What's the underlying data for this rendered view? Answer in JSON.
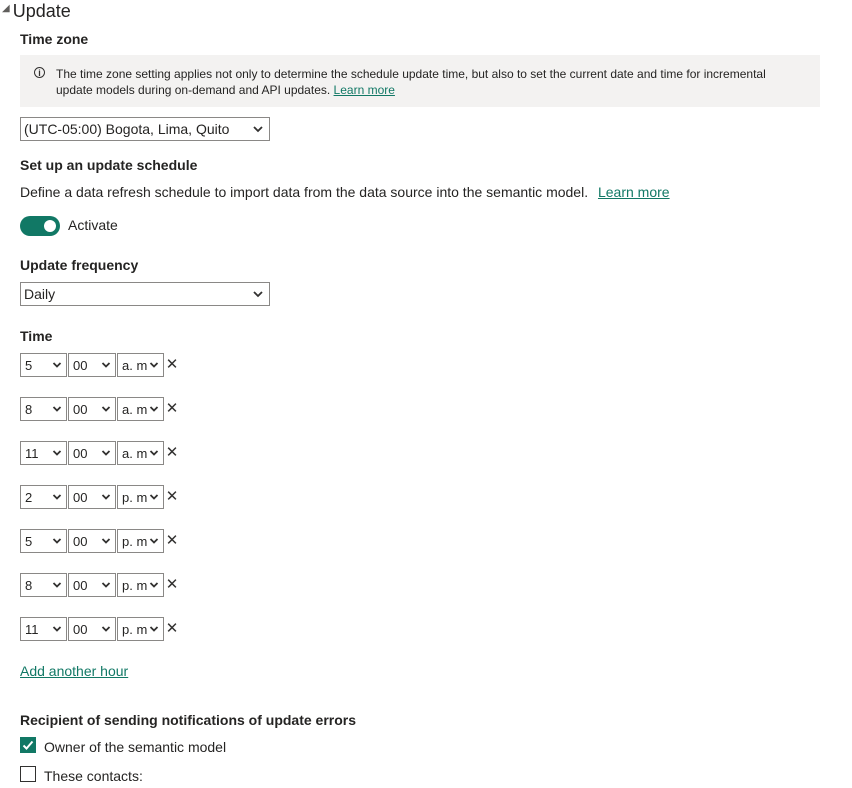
{
  "section": {
    "title": "Update",
    "collapse_icon": "collapse-triangle-icon"
  },
  "timezone": {
    "label": "Time zone",
    "info_text": "The time zone setting applies not only to determine the schedule update time, but also to set the current date and time for incremental update models during on-demand and API updates.",
    "info_link": "Learn more",
    "selected": "(UTC-05:00) Bogota, Lima, Quito"
  },
  "schedule": {
    "heading": "Set up an update schedule",
    "description": "Define a data refresh schedule to import data from the data source into the semantic model.",
    "learn_more": "Learn more",
    "toggle_label": "Activate",
    "toggle_on": true
  },
  "frequency": {
    "label": "Update frequency",
    "selected": "Daily"
  },
  "time": {
    "label": "Time",
    "rows": [
      {
        "hour": "5",
        "minute": "00",
        "ampm": "a. m."
      },
      {
        "hour": "8",
        "minute": "00",
        "ampm": "a. m."
      },
      {
        "hour": "11",
        "minute": "00",
        "ampm": "a. m."
      },
      {
        "hour": "2",
        "minute": "00",
        "ampm": "p. m."
      },
      {
        "hour": "5",
        "minute": "00",
        "ampm": "p. m."
      },
      {
        "hour": "8",
        "minute": "00",
        "ampm": "p. m."
      },
      {
        "hour": "11",
        "minute": "00",
        "ampm": "p. m."
      }
    ],
    "add_link": "Add another hour"
  },
  "notifications": {
    "heading": "Recipient of sending notifications of update errors",
    "owner_label": "Owner of the semantic model",
    "owner_checked": true,
    "contacts_label": "These contacts:",
    "contacts_checked": false
  },
  "colors": {
    "accent": "#117865",
    "info_bg": "#f3f2f1",
    "border": "#8a8886"
  }
}
